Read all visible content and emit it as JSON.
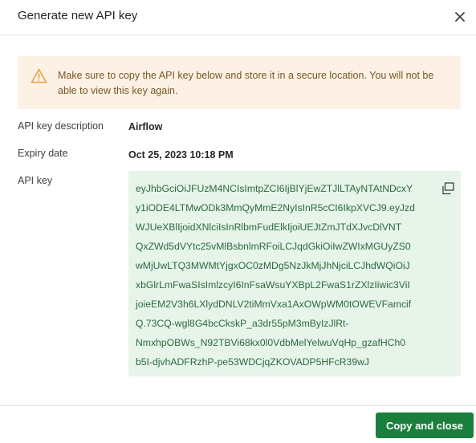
{
  "dialog": {
    "title": "Generate new API key"
  },
  "warning": {
    "text": "Make sure to copy the API key below and store it in a secure location. You will not be able to view this key again."
  },
  "fields": {
    "description_label": "API key description",
    "description_value": "Airflow",
    "expiry_label": "Expiry date",
    "expiry_value": "Oct 25, 2023 10:18 PM",
    "key_label": "API key"
  },
  "api_key_lines": [
    "eyJhbGciOiJFUzM4NCIsImtpZCI6IjBlYjEwZTJlLTAyNTAtNDcxY",
    "y1iODE4LTMwODk3MmQyMmE2NyIsInR5cCI6IkpXVCJ9.eyJzd",
    "WJUeXBlIjoidXNlciIsInRlbmFudElkIjoiUEJtZmJTdXJvcDlVNT",
    "QxZWd5dVYtc25vMlBsbnlmRFoiLCJqdGkiOiIwZWIxMGUyZS0",
    "wMjUwLTQ3MWMtYjgxOC0zMDg5NzJkMjJhNjciLCJhdWQiOiJ",
    "xbGlrLmFwaSIsImlzcyI6InFsaWsuYXBpL2FwaS1rZXlzIiwic3ViI",
    "joieEM2V3h6LXlydDNLV2tiMmVxa1AxOWpWM0tOWEVFamcif",
    "Q.73CQ-wgl8G4bcCkskP_a3dr55pM3mByIzJlRt-",
    "NmxhpOBWs_N92TBVi68kx0l0VdbMelYelwuVqHp_gzafHCh0",
    "b5I-djvhADFRzhP-pe53WDCjqZKOVADP5HFcR39wJ"
  ],
  "actions": {
    "copy_and_close_label": "Copy and close"
  },
  "icons": {
    "close": "close-icon",
    "warning": "warning-icon",
    "copy": "copy-icon"
  },
  "colors": {
    "warning_bg": "#fdf1e6",
    "warning_icon": "#e8a33d",
    "key_bg": "#e6f4ea",
    "primary": "#1a7f3c"
  }
}
